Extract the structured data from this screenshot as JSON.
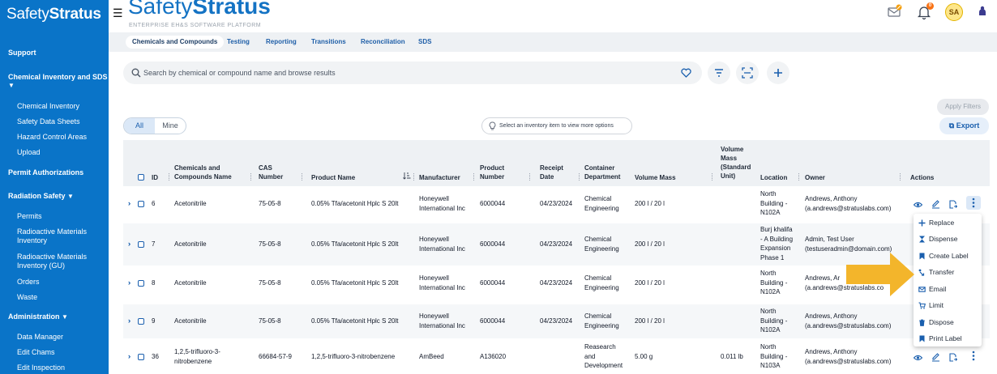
{
  "sidebar": {
    "brand_a": "Safety",
    "brand_b": "Stratus",
    "support": "Support",
    "chem_section": "Chemical Inventory and SDS",
    "chem_items": [
      "Chemical Inventory",
      "Safety Data Sheets",
      "Hazard Control Areas",
      "Upload"
    ],
    "permit_auth": "Permit Authorizations",
    "radiation": "Radiation Safety",
    "radiation_items": [
      "Permits",
      "Radioactive Materials Inventory",
      "Radioactive Materials Inventory (GU)",
      "Orders",
      "Waste"
    ],
    "administration": "Administration",
    "admin_items": [
      "Data Manager",
      "Edit Chams",
      "Edit Inspection"
    ]
  },
  "header": {
    "brand_a": "Safety",
    "brand_b": "Stratus",
    "tagline": "ENTERPRISE EH&S SOFTWARE PLATFORM",
    "notifications_count": "0",
    "avatar_initials": "SA",
    "colors": {
      "sidebar": "#0a74c8",
      "accent": "#1473c4",
      "highlight_arrow": "#f3b52b"
    }
  },
  "tabs": [
    "Chemicals and Compounds",
    "Testing",
    "Reporting",
    "Transitions",
    "Reconciliation",
    "SDS"
  ],
  "search": {
    "placeholder": "Search by chemical or compound name and browse results"
  },
  "toolbar": {
    "apply_filters": "Apply Filters",
    "export": "Export",
    "seg_all": "All",
    "seg_mine": "Mine",
    "hint": "Select an inventory item to view more options"
  },
  "table": {
    "headers": {
      "id": "ID",
      "name": [
        "Chemicals and",
        "Compounds Name"
      ],
      "cas": [
        "CAS",
        "Number"
      ],
      "product_name": "Product Name",
      "manufacturer": "Manufacturer",
      "product_number": [
        "Product",
        "Number"
      ],
      "receipt": [
        "Receipt",
        "Date"
      ],
      "container": [
        "Container",
        "Department"
      ],
      "volume_mass": "Volume Mass",
      "volume_std": [
        "Volume",
        "Mass",
        "(Standard",
        "Unit)"
      ],
      "location": "Location",
      "owner": "Owner",
      "actions": "Actions"
    },
    "rows": [
      {
        "id": "6",
        "name": [
          "Acetonitrile"
        ],
        "cas": "75-05-8",
        "product": "0.05% Tfa/acetonit Hplc S 20lt",
        "manufacturer": [
          "Honeywell",
          "International Inc"
        ],
        "product_number": "6000044",
        "receipt": "04/23/2024",
        "container": [
          "Chemical",
          "Engineering"
        ],
        "volume_mass": "200 l / 20 l",
        "volume_std": "",
        "location": [
          "North",
          "Building -",
          "N102A"
        ],
        "owner": [
          "Andrews, Anthony",
          "(a.andrews@stratuslabs.com)"
        ]
      },
      {
        "id": "7",
        "name": [
          "Acetonitrile"
        ],
        "cas": "75-05-8",
        "product": "0.05% Tfa/acetonit Hplc S 20lt",
        "manufacturer": [
          "Honeywell",
          "International Inc"
        ],
        "product_number": "6000044",
        "receipt": "04/23/2024",
        "container": [
          "Chemical",
          "Engineering"
        ],
        "volume_mass": "200 l / 20 l",
        "volume_std": "",
        "location": [
          "Burj khalifa",
          "- A Building",
          "Expansion",
          "Phase 1"
        ],
        "owner": [
          "Admin, Test User",
          "(testuseradmin@domain.com)"
        ]
      },
      {
        "id": "8",
        "name": [
          "Acetonitrile"
        ],
        "cas": "75-05-8",
        "product": "0.05% Tfa/acetonit Hplc S 20lt",
        "manufacturer": [
          "Honeywell",
          "International Inc"
        ],
        "product_number": "6000044",
        "receipt": "04/23/2024",
        "container": [
          "Chemical",
          "Engineering"
        ],
        "volume_mass": "200 l / 20 l",
        "volume_std": "",
        "location": [
          "North",
          "Building -",
          "N102A"
        ],
        "owner": [
          "Andrews, Ar",
          "(a.andrews@stratuslabs.co"
        ]
      },
      {
        "id": "9",
        "name": [
          "Acetonitrile"
        ],
        "cas": "75-05-8",
        "product": "0.05% Tfa/acetonit Hplc S 20lt",
        "manufacturer": [
          "Honeywell",
          "International Inc"
        ],
        "product_number": "6000044",
        "receipt": "04/23/2024",
        "container": [
          "Chemical",
          "Engineering"
        ],
        "volume_mass": "200 l / 20 l",
        "volume_std": "",
        "location": [
          "North",
          "Building -",
          "N102A"
        ],
        "owner": [
          "Andrews, Anthony",
          "(a.andrews@stratuslabs.com)"
        ]
      },
      {
        "id": "36",
        "name": [
          "1,2,5-trifluoro-3-",
          "nitrobenzene"
        ],
        "cas": "66684-57-9",
        "product": "1,2,5-trifluoro-3-nitrobenzene",
        "manufacturer": [
          "AmBeed"
        ],
        "product_number": "A136020",
        "receipt": "",
        "container": [
          "Reasearch",
          "and",
          "Development"
        ],
        "volume_mass": "5.00 g",
        "volume_std": "0.011 lb",
        "location": [
          "North",
          "Building -",
          "N103A"
        ],
        "owner": [
          "Andrews, Anthony",
          "(a.andrews@stratuslabs.com)"
        ]
      }
    ]
  },
  "actions_menu": [
    "Replace",
    "Dispense",
    "Create Label",
    "Transfer",
    "Email",
    "Limit",
    "Dispose",
    "Print Label"
  ]
}
